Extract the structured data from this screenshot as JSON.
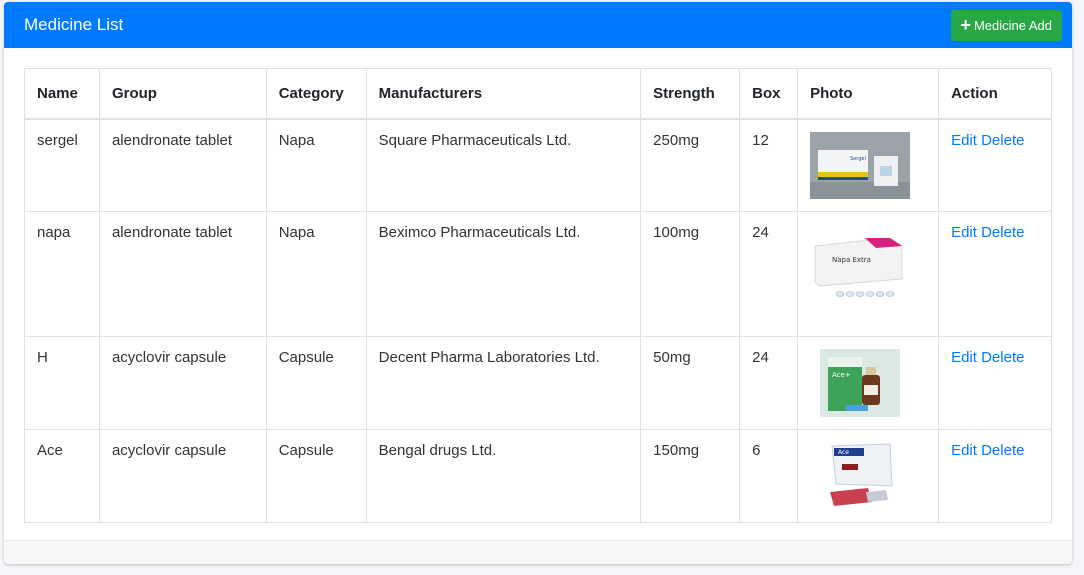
{
  "header": {
    "title": "Medicine List",
    "add_label": "Medicine Add"
  },
  "table": {
    "columns": [
      "Name",
      "Group",
      "Category",
      "Manufacturers",
      "Strength",
      "Box",
      "Photo",
      "Action"
    ],
    "rows": [
      {
        "name": "sergel",
        "group": "alendronate tablet",
        "category": "Napa",
        "manufacturer": "Square Pharmaceuticals Ltd.",
        "strength": "250mg",
        "box": "12",
        "photo_label": "Sergel",
        "edit": "Edit",
        "delete": "Delete"
      },
      {
        "name": "napa",
        "group": "alendronate tablet",
        "category": "Napa",
        "manufacturer": "Beximco Pharmaceuticals Ltd.",
        "strength": "100mg",
        "box": "24",
        "photo_label": "Napa Extra",
        "edit": "Edit",
        "delete": "Delete"
      },
      {
        "name": "H",
        "group": "acyclovir capsule",
        "category": "Capsule",
        "manufacturer": "Decent Pharma Laboratories Ltd.",
        "strength": "50mg",
        "box": "24",
        "photo_label": "Ace+",
        "edit": "Edit",
        "delete": "Delete"
      },
      {
        "name": "Ace",
        "group": "acyclovir capsule",
        "category": "Capsule",
        "manufacturer": "Bengal drugs Ltd.",
        "strength": "150mg",
        "box": "6",
        "photo_label": "Ace",
        "edit": "Edit",
        "delete": "Delete"
      }
    ]
  },
  "colors": {
    "primary": "#007bff",
    "success": "#28a745"
  }
}
